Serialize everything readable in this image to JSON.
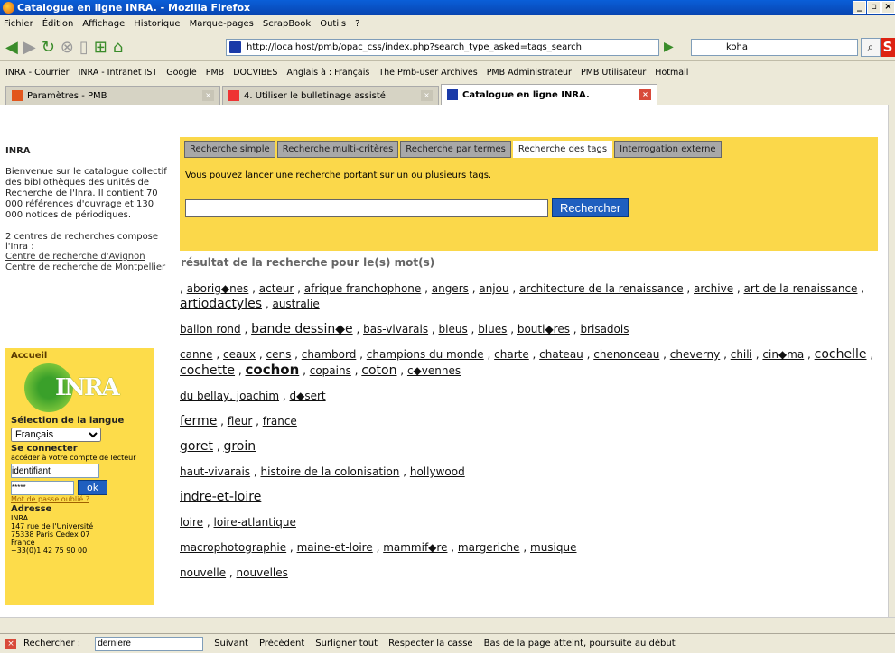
{
  "window": {
    "title": "Catalogue en ligne INRA. - Mozilla Firefox"
  },
  "menu": [
    "Fichier",
    "Édition",
    "Affichage",
    "Historique",
    "Marque-pages",
    "ScrapBook",
    "Outils",
    "?"
  ],
  "nav": {
    "url": "http://localhost/pmb/opac_css/index.php?search_type_asked=tags_search",
    "search_value": "koha"
  },
  "bookmarks": [
    "INRA - Courrier",
    "INRA - Intranet IST",
    "Google",
    "PMB",
    "DOCVIBES",
    "Anglais à : Français",
    "The Pmb-user Archives",
    "PMB Administrateur",
    "PMB Utilisateur",
    "Hotmail"
  ],
  "tabs": [
    "Paramètres - PMB",
    "4. Utiliser le bulletinage assisté",
    "Catalogue en ligne INRA."
  ],
  "sidebar": {
    "title": "INRA",
    "intro": "Bienvenue sur le catalogue collectif des bibliothèques des unités de Recherche de l'Inra. Il contient 70 000 références d'ouvrage et 130 000 notices de périodiques.",
    "centres_text": "2 centres de recherches compose l'Inra :",
    "link1": "Centre de recherche d'Avignon",
    "link2": "Centre de recherche de Montpellier",
    "accueil": "Accueil",
    "lang_label": "Sélection de la langue",
    "lang_value": "Français",
    "connect_title": "Se connecter",
    "connect_text": "accéder à votre compte de lecteur",
    "login_value": "identifiant",
    "password_value": "*****",
    "ok": "ok",
    "forgot": "Mot de passe oublié ?",
    "address_title": "Adresse",
    "address": [
      "INRA",
      "147 rue de l'Université",
      "75338 Paris Cedex 07",
      "France",
      "+33(0)1 42 75 90 00"
    ]
  },
  "search": {
    "tabs": [
      "Recherche simple",
      "Recherche multi-critères",
      "Recherche par termes",
      "Recherche des tags",
      "Interrogation externe"
    ],
    "description": "Vous pouvez lancer une recherche portant sur un ou plusieurs tags.",
    "button": "Rechercher",
    "result_title": "résultat de la recherche pour le(s) mot(s)"
  },
  "tag_lines": [
    [
      {
        "t": "aborig◆nes",
        "s": ""
      },
      {
        "t": "acteur",
        "s": ""
      },
      {
        "t": "afrique franchophone",
        "s": ""
      },
      {
        "t": "angers",
        "s": ""
      },
      {
        "t": "anjou",
        "s": ""
      },
      {
        "t": "architecture de la renaissance",
        "s": ""
      },
      {
        "t": "archive",
        "s": ""
      },
      {
        "t": "art de la renaissance",
        "s": ""
      },
      {
        "t": "artiodactyles",
        "s": "big"
      },
      {
        "t": "australie",
        "s": ""
      }
    ],
    [
      {
        "t": "ballon rond",
        "s": ""
      },
      {
        "t": "bande dessin◆e",
        "s": "big"
      },
      {
        "t": "bas-vivarais",
        "s": ""
      },
      {
        "t": "bleus",
        "s": ""
      },
      {
        "t": "blues",
        "s": ""
      },
      {
        "t": "bouti◆res",
        "s": ""
      },
      {
        "t": "brisadois",
        "s": ""
      }
    ],
    [
      {
        "t": "canne",
        "s": ""
      },
      {
        "t": "ceaux",
        "s": ""
      },
      {
        "t": "cens",
        "s": ""
      },
      {
        "t": "chambord",
        "s": ""
      },
      {
        "t": "champions du monde",
        "s": ""
      },
      {
        "t": "charte",
        "s": ""
      },
      {
        "t": "chateau",
        "s": ""
      },
      {
        "t": "chenonceau",
        "s": ""
      },
      {
        "t": "cheverny",
        "s": ""
      },
      {
        "t": "chili",
        "s": ""
      },
      {
        "t": "cin◆ma",
        "s": ""
      },
      {
        "t": "cochelle",
        "s": "big"
      },
      {
        "t": "cochette",
        "s": "big"
      },
      {
        "t": "cochon",
        "s": "bigger"
      },
      {
        "t": "copains",
        "s": ""
      },
      {
        "t": "coton",
        "s": "big"
      },
      {
        "t": "c◆vennes",
        "s": ""
      }
    ],
    [
      {
        "t": "du bellay, joachim",
        "s": ""
      },
      {
        "t": "d◆sert",
        "s": ""
      }
    ],
    [
      {
        "t": "ferme",
        "s": "big"
      },
      {
        "t": "fleur",
        "s": ""
      },
      {
        "t": "france",
        "s": ""
      }
    ],
    [
      {
        "t": "goret",
        "s": "big"
      },
      {
        "t": "groin",
        "s": "big"
      }
    ],
    [
      {
        "t": "haut-vivarais",
        "s": ""
      },
      {
        "t": "histoire de la colonisation",
        "s": ""
      },
      {
        "t": "hollywood",
        "s": ""
      }
    ],
    [
      {
        "t": "indre-et-loire",
        "s": "big"
      }
    ],
    [
      {
        "t": "loire",
        "s": ""
      },
      {
        "t": "loire-atlantique",
        "s": ""
      }
    ],
    [
      {
        "t": "macrophotographie",
        "s": ""
      },
      {
        "t": "maine-et-loire",
        "s": ""
      },
      {
        "t": "mammif◆re",
        "s": ""
      },
      {
        "t": "margeriche",
        "s": ""
      },
      {
        "t": "musique",
        "s": ""
      }
    ],
    [
      {
        "t": "nouvelle",
        "s": ""
      },
      {
        "t": "nouvelles",
        "s": ""
      }
    ]
  ],
  "findbar": {
    "label": "Rechercher :",
    "value": "derniere",
    "next": "Suivant",
    "prev": "Précédent",
    "highlight": "Surligner tout",
    "case": "Respecter la casse",
    "status": "Bas de la page atteint, poursuite au début"
  }
}
